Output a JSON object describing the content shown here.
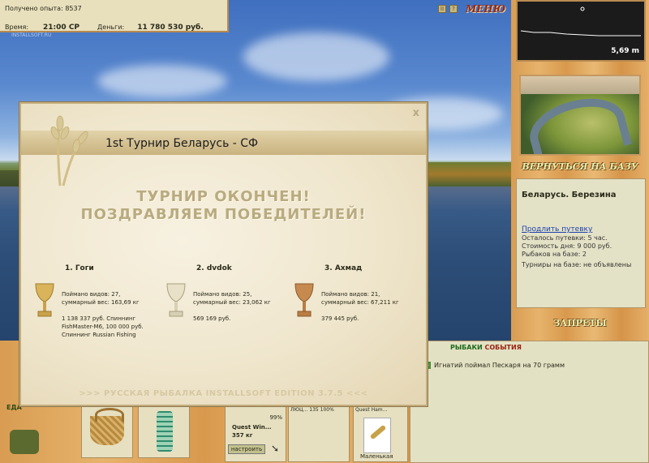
{
  "hud": {
    "experience_label": "Получено опыта: 8537",
    "time_label": "Время:",
    "time_value": "21:00 СР",
    "money_label": "Деньги:",
    "money_value": "11 780 530 руб.",
    "watermark": "INSTALLSOFT.RU"
  },
  "topbar": {
    "pause_icon": "pause-icon",
    "help_icon": "help-icon",
    "pause_glyph": "II",
    "help_glyph": "?",
    "menu_label": "МЕНЮ"
  },
  "right": {
    "depth_value": "5,69 m",
    "back_label": "ВЕРНУТЬСЯ НА БАЗУ",
    "base_title": "Беларусь. Березина",
    "extend_link": "Продлить путевку",
    "lines": [
      "Осталось путевки: 5 час.",
      "Стоимость дня: 9 000 руб.",
      "Рыбаков на базе: 2",
      "Турниры на базе: не объявлены"
    ],
    "bans_label": "ЗАПРЕТЫ"
  },
  "news": {
    "head_a": "РЫБАКИ",
    "head_b": "СОБЫТИЯ",
    "line": "Игнатий поймал Пескаря на 70 грамм"
  },
  "inventory": {
    "food_label": "ЕДА",
    "rod_percent": "99%",
    "rod_name": "Quest Win...",
    "rod_weight": "357 кг",
    "setup_label": "настроить",
    "mid_header": "ЛЮЦ...     135        100%",
    "lure_header": "Quest Ham...",
    "lure_caption": "Маленькая"
  },
  "dialog": {
    "title": "1st Турнир Беларусь - СФ",
    "close": "x",
    "headline1": "ТУРНИР ОКОНЧЕН!",
    "headline2": "ПОЗДРАВЛЯЕМ ПОБЕДИТЕЛЕЙ!",
    "winners": [
      {
        "name": "1. Гоги",
        "stats1": "Поймано видов: 27,",
        "stats2": "суммарный вес: 163,69 кг",
        "prize1": "1 138 337 руб. Спиннинг",
        "prize2": "FishMaster-M6, 100 000 руб.",
        "prize3": "Спиннинг Russian Fishing",
        "cup": "gold-cup-icon"
      },
      {
        "name": "2. dvdok",
        "stats1": "Поймано видов: 25,",
        "stats2": "суммарный вес: 23,062 кг",
        "prize1": "569 169 руб.",
        "prize2": "",
        "prize3": "",
        "cup": "silver-cup-icon"
      },
      {
        "name": "3. Ахмад",
        "stats1": "Поймано видов: 21,",
        "stats2": "суммарный вес: 67,211 кг",
        "prize1": "379 445 руб.",
        "prize2": "",
        "prize3": "",
        "cup": "bronze-cup-icon"
      }
    ],
    "footer": ">>> РУССКАЯ РЫБАЛКА INSTALLSOFT EDITION 3.7.5 <<<"
  },
  "colors": {
    "menu": "#9a2a12",
    "link": "#1a3fae",
    "gold": "#d9b45a",
    "silver": "#cfcfcf",
    "bronze": "#c78a4e"
  }
}
